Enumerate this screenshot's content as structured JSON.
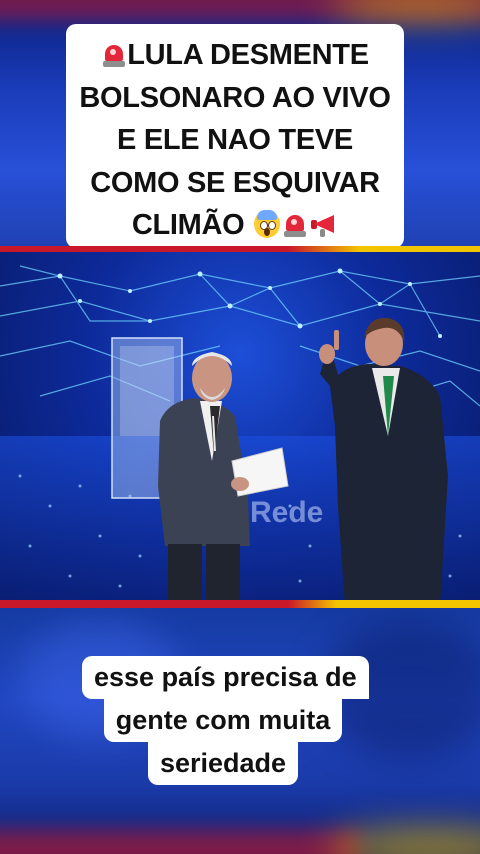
{
  "title_card": {
    "lines": [
      "LULA DESMENTE",
      "BOLSONARO AO VIVO",
      "E ELE NAO TEVE",
      "COMO SE ESQUIVAR",
      "CLIMÃO"
    ],
    "leading_emoji": "police-siren-icon",
    "trailing_emojis": [
      "screaming-face-icon",
      "police-siren-icon",
      "megaphone-icon"
    ]
  },
  "video": {
    "podium_text": "Rede"
  },
  "subtitle": {
    "lines": [
      "esse país precisa de",
      "gente com muita",
      "seriedade"
    ]
  },
  "colors": {
    "brand_red": "#c8182a",
    "brand_yellow": "#f3c400",
    "stage_blue": "#1d4fd8"
  }
}
